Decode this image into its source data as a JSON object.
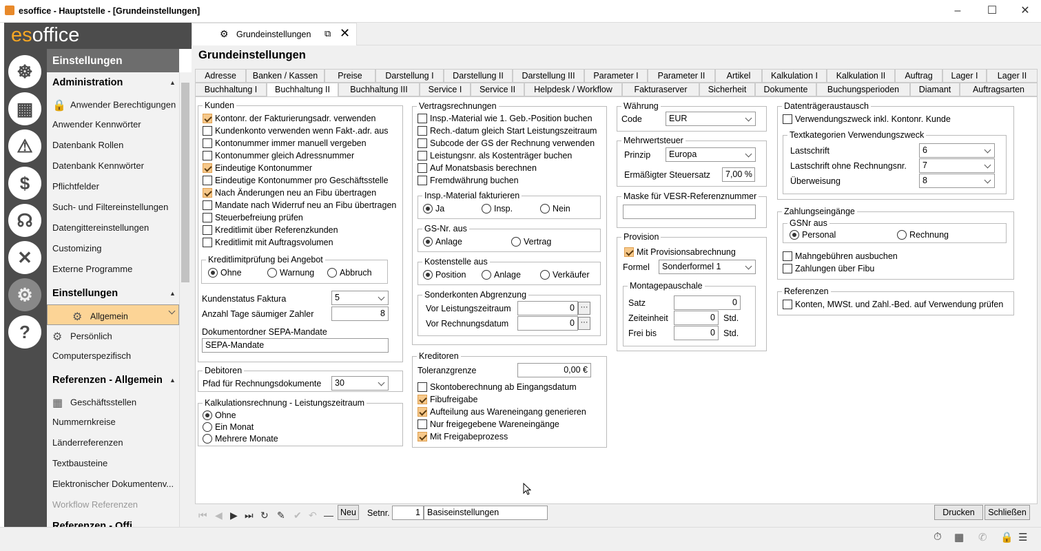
{
  "window": {
    "title": "esoffice - Hauptstelle - [Grundeinstellungen]",
    "minimize": "–",
    "maximize": "☐",
    "close": "✕"
  },
  "logo": {
    "brand": "es",
    "rest": "office"
  },
  "iconbar": [
    "steering-wheel-icon",
    "building-icon",
    "alarm-light-icon",
    "money-icon",
    "headset-icon",
    "tools-icon",
    "gears-icon",
    "help-icon"
  ],
  "nav": {
    "header": "Einstellungen",
    "sec_admin": "Administration",
    "admin_items": [
      "Anwender Berechtigungen",
      "Anwender Kennwörter",
      "Datenbank Rollen",
      "Datenbank Kennwörter",
      "Pflichtfelder",
      "Such- und Filtereinstellungen",
      "Datengittereinstellungen",
      "Customizing",
      "Externe Programme"
    ],
    "sec_einst": "Einstellungen",
    "einst_items": [
      "Allgemein",
      "Persönlich",
      "Computerspezifisch"
    ],
    "sec_ref": "Referenzen - Allgemein",
    "ref_items": [
      "Geschäftsstellen",
      "Nummernkreise",
      "Länderreferenzen",
      "Textbausteine",
      "Elektronischer Dokumentenv...",
      "Workflow Referenzen"
    ],
    "sec_more": "Referenzen - Offi..."
  },
  "doctab": {
    "label": "Grundeinstellungen"
  },
  "page_title": "Grundeinstellungen",
  "tabs_row1": [
    "Adresse",
    "Banken / Kassen",
    "Preise",
    "Darstellung I",
    "Darstellung II",
    "Darstellung III",
    "Parameter I",
    "Parameter II",
    "Artikel",
    "Kalkulation I",
    "Kalkulation II",
    "Auftrag",
    "Lager I",
    "Lager II"
  ],
  "tabs_row2": [
    "Buchhaltung I",
    "Buchhaltung II",
    "Buchhaltung III",
    "Service I",
    "Service II",
    "Helpdesk / Workflow",
    "Fakturaserver",
    "Sicherheit",
    "Dokumente",
    "Buchungsperioden",
    "Diamant",
    "Auftragsarten"
  ],
  "kunden": {
    "legend": "Kunden",
    "checks": [
      {
        "label": "Kontonr. der Fakturierungsadr. verwenden",
        "checked": true
      },
      {
        "label": "Kundenkonto verwenden wenn Fakt-.adr. aus",
        "checked": false
      },
      {
        "label": "Kontonummer immer manuell vergeben",
        "checked": false
      },
      {
        "label": "Kontonummer gleich Adressnummer",
        "checked": false
      },
      {
        "label": "Eindeutige Kontonummer",
        "checked": true
      },
      {
        "label": "Eindeutige Kontonummer pro Geschäftsstelle",
        "checked": false
      },
      {
        "label": "Nach Änderungen neu an Fibu übertragen",
        "checked": true
      },
      {
        "label": "Mandate nach Widerruf neu an Fibu übertragen",
        "checked": false
      },
      {
        "label": "Steuerbefreiung prüfen",
        "checked": false
      },
      {
        "label": "Kreditlimit über Referenzkunden",
        "checked": false
      },
      {
        "label": "Kreditlimit mit Auftragsvolumen",
        "checked": false
      }
    ],
    "kredit_legend": "Kreditlimitprüfung bei Angebot",
    "kredit_opts": [
      "Ohne",
      "Warnung",
      "Abbruch"
    ],
    "status_label": "Kundenstatus Faktura",
    "status_value": "5",
    "tage_label": "Anzahl Tage säumiger Zahler",
    "tage_value": "8",
    "ordner_label": "Dokumentordner SEPA-Mandate",
    "ordner_value": "SEPA-Mandate"
  },
  "debitoren": {
    "legend": "Debitoren",
    "pfad_label": "Pfad für Rechnungsdokumente",
    "pfad_value": "30"
  },
  "kalk": {
    "legend": "Kalkulationsrechnung - Leistungszeitraum",
    "opts": [
      "Ohne",
      "Ein Monat",
      "Mehrere Monate"
    ]
  },
  "vertrag": {
    "legend": "Vertragsrechnungen",
    "checks": [
      "Insp.-Material wie 1. Geb.-Position buchen",
      "Rech.-datum gleich Start Leistungszeitraum",
      "Subcode der GS der Rechnung verwenden",
      "Leistungsnr. als Kostenträger buchen",
      "Auf Monatsbasis berechnen",
      "Fremdwährung buchen"
    ],
    "insp_legend": "Insp.-Material fakturieren",
    "insp_opts": [
      "Ja",
      "Insp.",
      "Nein"
    ],
    "gs_legend": "GS-Nr. aus",
    "gs_opts": [
      "Anlage",
      "Vertrag"
    ],
    "kst_legend": "Kostenstelle aus",
    "kst_opts": [
      "Position",
      "Anlage",
      "Verkäufer"
    ],
    "sk_legend": "Sonderkonten Abgrenzung",
    "sk_row1": "Vor Leistungszeitraum",
    "sk_val1": "0",
    "sk_row2": "Vor Rechnungsdatum",
    "sk_val2": "0",
    "dots": "···"
  },
  "kreditoren": {
    "legend": "Kreditoren",
    "tol_label": "Toleranzgrenze",
    "tol_value": "0,00 €",
    "checks": [
      {
        "label": "Skontoberechnung ab Eingangsdatum",
        "checked": false
      },
      {
        "label": "Fibufreigabe",
        "checked": true
      },
      {
        "label": "Aufteilung aus Wareneingang generieren",
        "checked": true
      },
      {
        "label": "Nur freigegebene Wareneingänge",
        "checked": false
      },
      {
        "label": "Mit Freigabeprozess",
        "checked": true
      }
    ]
  },
  "waehrung": {
    "legend": "Währung",
    "code_label": "Code",
    "code_value": "EUR"
  },
  "mwst": {
    "legend": "Mehrwertsteuer",
    "prinzip_label": "Prinzip",
    "prinzip_value": "Europa",
    "satz_label": "Ermäßigter Steuersatz",
    "satz_value": "7,00 %"
  },
  "vesr": {
    "legend": "Maske für VESR-Referenznummer",
    "value": ""
  },
  "provision": {
    "legend": "Provision",
    "check": "Mit Provisionsabrechnung",
    "formel_label": "Formel",
    "formel_value": "Sonderformel 1",
    "montage_legend": "Montagepauschale",
    "satz_label": "Satz",
    "satz_value": "0",
    "zeit_label": "Zeiteinheit",
    "zeit_value": "0",
    "zeit_unit": "Std.",
    "frei_label": "Frei bis",
    "frei_value": "0",
    "frei_unit": "Std."
  },
  "dta": {
    "legend": "Datenträgeraustausch",
    "check": "Verwendungszweck inkl. Kontonr. Kunde",
    "tk_legend": "Textkategorien Verwendungszweck",
    "rows": [
      {
        "label": "Lastschrift",
        "value": "6"
      },
      {
        "label": "Lastschrift ohne Rechnungsnr.",
        "value": "7"
      },
      {
        "label": "Überweisung",
        "value": "8"
      }
    ]
  },
  "zahl": {
    "legend": "Zahlungseingänge",
    "gsnr_legend": "GSNr aus",
    "gsnr_opts": [
      "Personal",
      "Rechnung"
    ],
    "checks": [
      "Mahngebühren ausbuchen",
      "Zahlungen über Fibu"
    ]
  },
  "refs": {
    "legend": "Referenzen",
    "check": "Konten, MWSt. und Zahl.-Bed. auf Verwendung prüfen"
  },
  "toolbar": {
    "neu": "Neu",
    "setnr_label": "Setnr.",
    "setnr_value": "1",
    "set_name": "Basiseinstellungen",
    "drucken": "Drucken",
    "schliessen": "Schließen"
  }
}
